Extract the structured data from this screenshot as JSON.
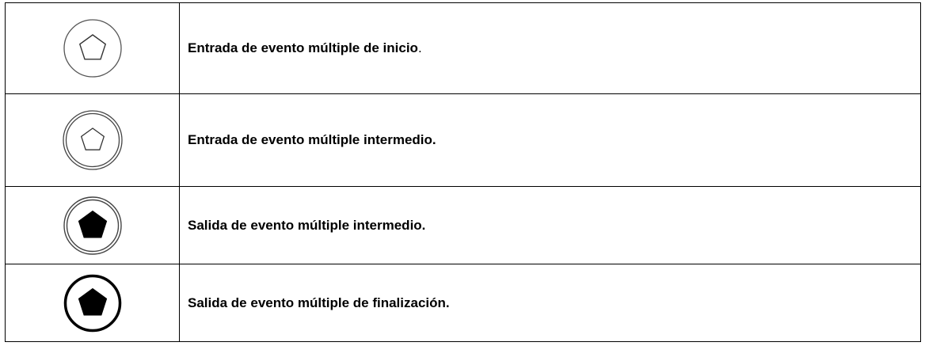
{
  "rows": [
    {
      "icon": "start-multiple-event-icon",
      "text": "Entrada de evento múltiple de inicio",
      "suffix": "."
    },
    {
      "icon": "intermediate-catch-multiple-event-icon",
      "text": "Entrada de evento múltiple intermedio.",
      "suffix": ""
    },
    {
      "icon": "intermediate-throw-multiple-event-icon",
      "text": "Salida de evento múltiple intermedio.",
      "suffix": ""
    },
    {
      "icon": "end-multiple-event-icon",
      "text": "Salida de evento múltiple de finalización.",
      "suffix": ""
    }
  ],
  "colors": {
    "stroke": "#000000",
    "fill": "#000000",
    "background": "#ffffff"
  }
}
